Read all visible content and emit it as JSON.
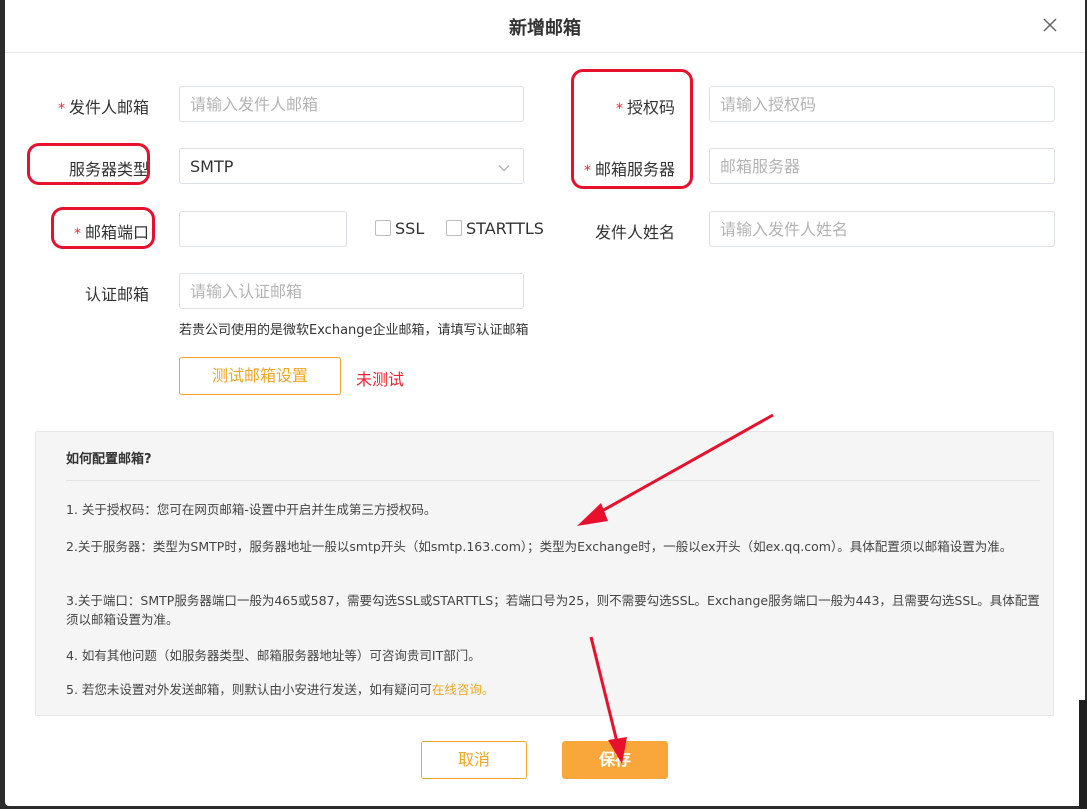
{
  "dialog": {
    "title": "新增邮箱"
  },
  "form": {
    "sender_email": {
      "label": "发件人邮箱",
      "value": "",
      "placeholder": "请输入发件人邮箱"
    },
    "auth_code": {
      "label": "授权码",
      "value": "",
      "placeholder": "请输入授权码"
    },
    "server_type": {
      "label": "服务器类型",
      "selected": "SMTP"
    },
    "mail_server": {
      "label": "邮箱服务器",
      "value": "",
      "placeholder": "邮箱服务器"
    },
    "mail_port": {
      "label": "邮箱端口",
      "value": "",
      "placeholder": ""
    },
    "ssl_label": "SSL",
    "starttls_label": "STARTTLS",
    "sender_name": {
      "label": "发件人姓名",
      "value": "",
      "placeholder": "请输入发件人姓名"
    },
    "auth_email": {
      "label": "认证邮箱",
      "value": "",
      "placeholder": "请输入认证邮箱"
    },
    "auth_email_hint": "若贵公司使用的是微软Exchange企业邮箱，请填写认证邮箱",
    "test_button": "测试邮箱设置",
    "test_status": "未测试",
    "required_mark": "*"
  },
  "help": {
    "title": "如何配置邮箱?",
    "items": [
      "1. 关于授权码：您可在网页邮箱-设置中开启并生成第三方授权码。",
      "2.关于服务器：类型为SMTP时，服务器地址一般以smtp开头（如smtp.163.com）；类型为Exchange时，一般以ex开头（如ex.qq.com）。具体配置须以邮箱设置为准。",
      "3.关于端口：SMTP服务器端口一般为465或587，需要勾选SSL或STARTTLS；若端口号为25，则不需要勾选SSL。Exchange服务端口一般为443，且需要勾选SSL。具体配置须以邮箱设置为准。",
      "4. 如有其他问题（如服务器类型、邮箱服务器地址等）可咨询贵司IT部门。"
    ],
    "item5_prefix": "5. 若您未设置对外发送邮箱，则默认由小安进行发送，如有疑问可",
    "item5_link": "在线咨询。"
  },
  "footer": {
    "cancel": "取消",
    "save": "保存"
  },
  "colors": {
    "accent": "#f5a623",
    "required": "#f5222d",
    "annotation": "#e8112d"
  }
}
